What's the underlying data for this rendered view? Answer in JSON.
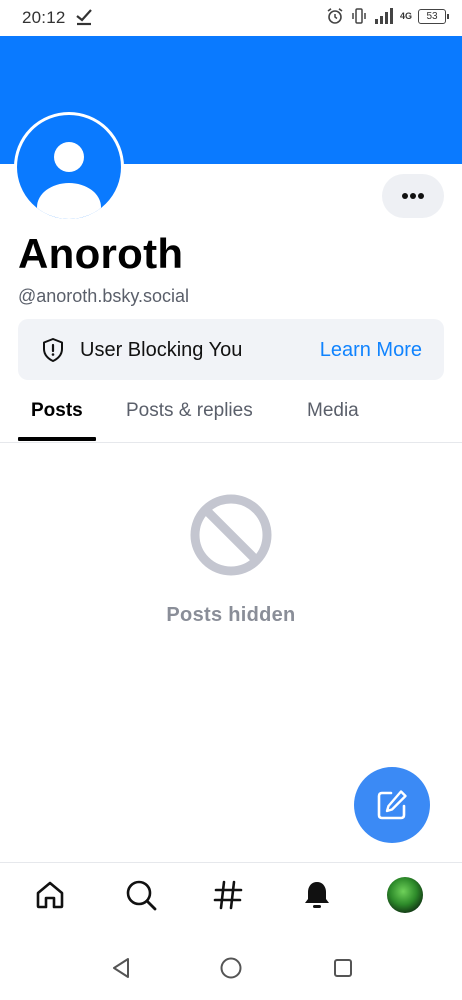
{
  "status_bar": {
    "time": "20:12",
    "network": "4G",
    "battery": "53"
  },
  "colors": {
    "banner": "#0a7aff",
    "accent_link": "#1083fe",
    "fab": "#3b8af5",
    "blocked_box_bg": "#f1f3f7"
  },
  "profile": {
    "display_name": "Anoroth",
    "handle": "@anoroth.bsky.social",
    "avatar_icon": "default-user-avatar-icon",
    "more_icon": "ellipsis-icon"
  },
  "blocked_notice": {
    "icon": "shield-icon",
    "label": "User Blocking You",
    "link": "Learn More"
  },
  "tabs": [
    {
      "label": "Posts",
      "active": true
    },
    {
      "label": "Posts & replies",
      "active": false
    },
    {
      "label": "Media",
      "active": false
    }
  ],
  "empty_state": {
    "icon": "no-entry-icon",
    "text": "Posts hidden"
  },
  "fab": {
    "icon": "compose-icon"
  },
  "bottom_nav": [
    {
      "icon": "home-icon"
    },
    {
      "icon": "search-icon"
    },
    {
      "icon": "hashtag-icon"
    },
    {
      "icon": "bell-icon"
    },
    {
      "icon": "profile-avatar-icon"
    }
  ],
  "system_nav": [
    {
      "icon": "back-triangle-icon"
    },
    {
      "icon": "home-circle-icon"
    },
    {
      "icon": "recents-square-icon"
    }
  ]
}
